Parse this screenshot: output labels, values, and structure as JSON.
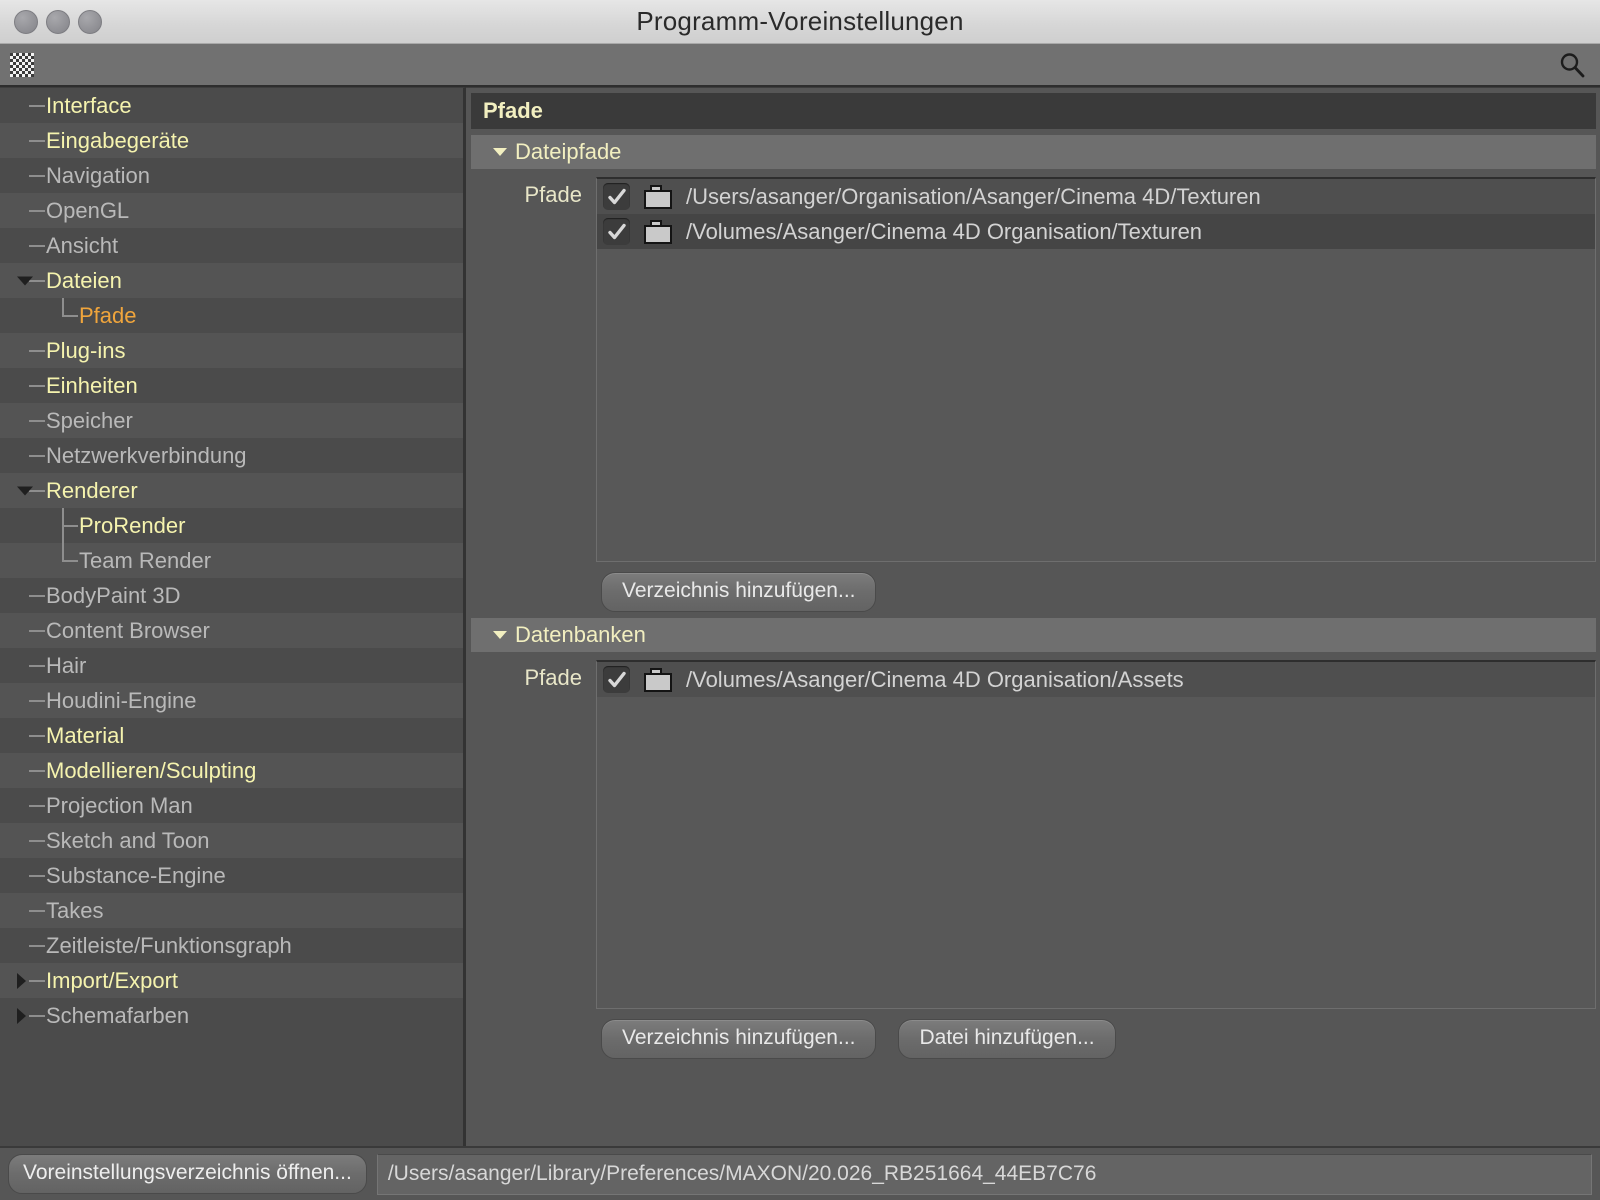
{
  "window": {
    "title": "Programm-Voreinstellungen",
    "traffic_lights": [
      "close-button",
      "minimize-button",
      "zoom-button"
    ]
  },
  "toolbar": {
    "grip_icon": "dotted-grip-icon",
    "search_icon": "search-icon"
  },
  "sidebar": {
    "items": [
      {
        "label": "Interface",
        "depth": 1,
        "state": "modified",
        "toggle": "none"
      },
      {
        "label": "Eingabegeräte",
        "depth": 1,
        "state": "modified",
        "toggle": "none"
      },
      {
        "label": "Navigation",
        "depth": 1,
        "state": "default",
        "toggle": "none"
      },
      {
        "label": "OpenGL",
        "depth": 1,
        "state": "default",
        "toggle": "none"
      },
      {
        "label": "Ansicht",
        "depth": 1,
        "state": "default",
        "toggle": "none"
      },
      {
        "label": "Dateien",
        "depth": 1,
        "state": "modified",
        "toggle": "open"
      },
      {
        "label": "Pfade",
        "depth": 2,
        "state": "active",
        "toggle": "none"
      },
      {
        "label": "Plug-ins",
        "depth": 1,
        "state": "modified",
        "toggle": "none"
      },
      {
        "label": "Einheiten",
        "depth": 1,
        "state": "modified",
        "toggle": "none"
      },
      {
        "label": "Speicher",
        "depth": 1,
        "state": "default",
        "toggle": "none"
      },
      {
        "label": "Netzwerkverbindung",
        "depth": 1,
        "state": "default",
        "toggle": "none"
      },
      {
        "label": "Renderer",
        "depth": 1,
        "state": "modified",
        "toggle": "open"
      },
      {
        "label": "ProRender",
        "depth": 2,
        "state": "modified",
        "toggle": "none"
      },
      {
        "label": "Team Render",
        "depth": 2,
        "state": "default",
        "toggle": "none"
      },
      {
        "label": "BodyPaint 3D",
        "depth": 1,
        "state": "default",
        "toggle": "none"
      },
      {
        "label": "Content Browser",
        "depth": 1,
        "state": "default",
        "toggle": "none"
      },
      {
        "label": "Hair",
        "depth": 1,
        "state": "default",
        "toggle": "none"
      },
      {
        "label": "Houdini-Engine",
        "depth": 1,
        "state": "default",
        "toggle": "none"
      },
      {
        "label": "Material",
        "depth": 1,
        "state": "modified",
        "toggle": "none"
      },
      {
        "label": "Modellieren/Sculpting",
        "depth": 1,
        "state": "modified",
        "toggle": "none"
      },
      {
        "label": "Projection Man",
        "depth": 1,
        "state": "default",
        "toggle": "none"
      },
      {
        "label": "Sketch and Toon",
        "depth": 1,
        "state": "default",
        "toggle": "none"
      },
      {
        "label": "Substance-Engine",
        "depth": 1,
        "state": "default",
        "toggle": "none"
      },
      {
        "label": "Takes",
        "depth": 1,
        "state": "default",
        "toggle": "none"
      },
      {
        "label": "Zeitleiste/Funktionsgraph",
        "depth": 1,
        "state": "default",
        "toggle": "none"
      },
      {
        "label": "Import/Export",
        "depth": 1,
        "state": "modified",
        "toggle": "closed"
      },
      {
        "label": "Schemafarben",
        "depth": 1,
        "state": "default",
        "toggle": "closed"
      }
    ]
  },
  "content": {
    "panel_title": "Pfade",
    "groups": [
      {
        "heading": "Dateipfade",
        "field_label": "Pfade",
        "rows": [
          {
            "checked": true,
            "icon": "folder-icon",
            "path": "/Users/asanger/Organisation/Asanger/Cinema 4D/Texturen"
          },
          {
            "checked": true,
            "icon": "folder-icon",
            "path": "/Volumes/Asanger/Cinema 4D Organisation/Texturen"
          }
        ],
        "buttons": [
          "Verzeichnis hinzufügen..."
        ]
      },
      {
        "heading": "Datenbanken",
        "field_label": "Pfade",
        "rows": [
          {
            "checked": true,
            "icon": "folder-icon",
            "path": "/Volumes/Asanger/Cinema 4D Organisation/Assets"
          }
        ],
        "buttons": [
          "Verzeichnis hinzufügen...",
          "Datei hinzufügen..."
        ]
      }
    ]
  },
  "statusbar": {
    "open_prefs_button": "Voreinstellungsverzeichnis öffnen...",
    "prefs_path": "/Users/asanger/Library/Preferences/MAXON/20.026_RB251664_44EB7C76"
  },
  "colors": {
    "modified_text": "#f5f3ae",
    "default_text": "#b9b9b9",
    "active_text": "#f0a53c",
    "heading_text": "#f2efc0",
    "window_bg": "#565656",
    "sidebar_bg": "#4b4b4b"
  }
}
